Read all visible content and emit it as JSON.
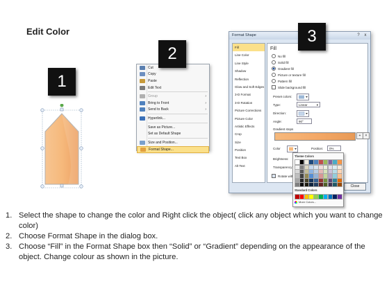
{
  "page": {
    "title": "Edit Color"
  },
  "badges": {
    "one": "1",
    "two": "2",
    "three": "3"
  },
  "shape": {
    "fill_color": "#f6b97c",
    "stroke_color": "#a5a5a5",
    "rotate_handle_color": "#5aa84a"
  },
  "context_menu": {
    "items": [
      {
        "label": "Cut",
        "icon": "scissors-icon",
        "disabled": false,
        "submenu": false
      },
      {
        "label": "Copy",
        "icon": "copy-icon",
        "disabled": false,
        "submenu": false
      },
      {
        "label": "Paste",
        "icon": "paste-icon",
        "disabled": false,
        "submenu": false
      },
      {
        "label": "Edit Text",
        "icon": "edit-text-icon",
        "disabled": false,
        "submenu": false
      },
      {
        "label": "Group",
        "icon": "group-icon",
        "disabled": true,
        "submenu": true
      },
      {
        "label": "Bring to Front",
        "icon": "bring-front-icon",
        "disabled": false,
        "submenu": true
      },
      {
        "label": "Send to Back",
        "icon": "send-back-icon",
        "disabled": false,
        "submenu": true
      },
      {
        "label": "Hyperlink...",
        "icon": "hyperlink-icon",
        "disabled": false,
        "submenu": false
      },
      {
        "label": "Save as Picture...",
        "icon": "",
        "disabled": false,
        "submenu": false
      },
      {
        "label": "Set as Default Shape",
        "icon": "",
        "disabled": false,
        "submenu": false
      },
      {
        "label": "Size and Position...",
        "icon": "size-icon",
        "disabled": false,
        "submenu": false
      },
      {
        "label": "Format Shape...",
        "icon": "format-shape-icon",
        "disabled": false,
        "submenu": false,
        "highlighted": true
      }
    ]
  },
  "dialog": {
    "title": "Format Shape",
    "help": "?",
    "close_x": "x",
    "nav": [
      "Fill",
      "Line Color",
      "Line Style",
      "Shadow",
      "Reflection",
      "Glow and Soft Edges",
      "3-D Format",
      "3-D Rotation",
      "Picture Corrections",
      "Picture Color",
      "Artistic Effects",
      "Crop",
      "Size",
      "Position",
      "Text Box",
      "Alt Text"
    ],
    "fill_heading": "Fill",
    "options": [
      "No fill",
      "Solid fill",
      "Gradient fill",
      "Picture or texture fill",
      "Pattern fill",
      "Slide background fill"
    ],
    "preset_colors": "Preset colors:",
    "type": {
      "label": "Type:",
      "value": "Linear"
    },
    "direction": "Direction:",
    "angle": {
      "label": "Angle:",
      "value": "90°"
    },
    "gradient_stops": "Gradient stops",
    "color": "Color",
    "position": {
      "label": "Position:",
      "value": "0%"
    },
    "brightness": "Brightness:",
    "transparency": "Transparency:",
    "rotate_with_shape": "Rotate with shape",
    "close_button": "Close"
  },
  "palette": {
    "theme_heading": "Theme Colors",
    "standard_heading": "Standard Colors",
    "more_colors": "More Colors...",
    "theme_top": [
      "#ffffff",
      "#000000",
      "#eeece1",
      "#1f497d",
      "#4f81bd",
      "#c0504d",
      "#9bbb59",
      "#8064a2",
      "#4bacc6",
      "#f79646"
    ],
    "theme_shade_rows": [
      [
        "#f2f2f2",
        "#7f7f7f",
        "#ddd9c3",
        "#c6d9f0",
        "#dbe5f1",
        "#f2dcdb",
        "#ebf1dd",
        "#e5e0ec",
        "#dbeef3",
        "#fdeada"
      ],
      [
        "#d8d8d8",
        "#595959",
        "#c4bd97",
        "#8db3e2",
        "#b8cce4",
        "#e5b9b7",
        "#d7e3bc",
        "#ccc1d9",
        "#b7dde8",
        "#fbd5b5"
      ],
      [
        "#bfbfbf",
        "#3f3f3f",
        "#938953",
        "#548dd4",
        "#95b3d7",
        "#d99694",
        "#c3d69b",
        "#b2a2c7",
        "#92cddc",
        "#fac08f"
      ],
      [
        "#a5a5a5",
        "#262626",
        "#494429",
        "#17365d",
        "#366092",
        "#953734",
        "#76923c",
        "#5f497a",
        "#31859b",
        "#e36c09"
      ],
      [
        "#7f7f7f",
        "#0c0c0c",
        "#1d1b10",
        "#0f243e",
        "#244061",
        "#632423",
        "#4f6128",
        "#3f3151",
        "#205867",
        "#974806"
      ]
    ],
    "standard": [
      "#c00000",
      "#ff0000",
      "#ffc000",
      "#ffff00",
      "#92d050",
      "#00b050",
      "#00b0f0",
      "#0070c0",
      "#002060",
      "#7030a0"
    ]
  },
  "instructions": [
    {
      "num": "1.",
      "text": "Select the shape to change the color and Right click the object( click any object which you want to change color)"
    },
    {
      "num": "2.",
      "text": "Choose Format Shape in the dialog box."
    },
    {
      "num": "3.",
      "text": "Choose “Fill” in the Format Shape box then “Solid” or “Gradient” depending on the appearance of the object. Change colour as shown in the picture."
    }
  ]
}
